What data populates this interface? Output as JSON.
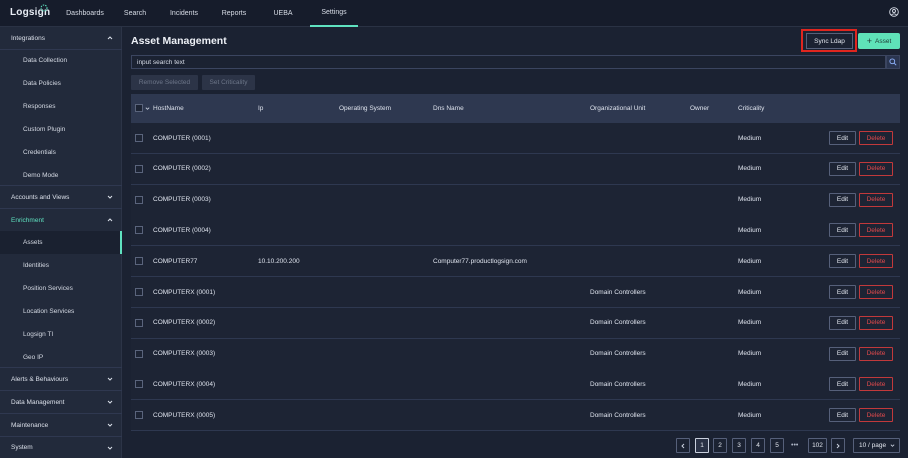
{
  "app": {
    "logo": "Logsign"
  },
  "nav": [
    {
      "label": "Dashboards",
      "active": false
    },
    {
      "label": "Search",
      "active": false
    },
    {
      "label": "Incidents",
      "active": false
    },
    {
      "label": "Reports",
      "active": false
    },
    {
      "label": "UEBA",
      "active": false
    },
    {
      "label": "Settings",
      "active": true
    }
  ],
  "sidebar": {
    "groups": [
      {
        "label": "Integrations",
        "expanded": true,
        "items": [
          "Data Collection",
          "Data Policies",
          "Responses",
          "Custom Plugin",
          "Credentials",
          "Demo Mode"
        ]
      },
      {
        "label": "Accounts and Views",
        "expanded": false,
        "items": []
      },
      {
        "label": "Enrichment",
        "expanded": true,
        "items": [
          "Assets",
          "Identities",
          "Position Services",
          "Location Services",
          "Logsign TI",
          "Geo IP"
        ]
      },
      {
        "label": "Alerts & Behaviours",
        "expanded": false,
        "items": []
      },
      {
        "label": "Data Management",
        "expanded": false,
        "items": []
      },
      {
        "label": "Maintenance",
        "expanded": false,
        "items": []
      },
      {
        "label": "System",
        "expanded": false,
        "items": []
      }
    ],
    "active_item": "Assets"
  },
  "page": {
    "title": "Asset Management",
    "sync_button": "Sync Ldap",
    "add_button": "Asset",
    "search_placeholder": "input search text",
    "remove_selected": "Remove Selected",
    "set_criticality": "Set Criticality"
  },
  "table": {
    "columns": [
      "HostName",
      "Ip",
      "Operating System",
      "Dns Name",
      "Organizational Unit",
      "Owner",
      "Criticality"
    ],
    "edit_label": "Edit",
    "delete_label": "Delete",
    "rows": [
      {
        "hostname": "COMPUTER (0001)",
        "ip": "",
        "os": "",
        "dns": "",
        "ou": "",
        "owner": "",
        "criticality": "Medium"
      },
      {
        "hostname": "COMPUTER (0002)",
        "ip": "",
        "os": "",
        "dns": "",
        "ou": "",
        "owner": "",
        "criticality": "Medium"
      },
      {
        "hostname": "COMPUTER (0003)",
        "ip": "",
        "os": "",
        "dns": "",
        "ou": "",
        "owner": "",
        "criticality": "Medium"
      },
      {
        "hostname": "COMPUTER (0004)",
        "ip": "",
        "os": "",
        "dns": "",
        "ou": "",
        "owner": "",
        "criticality": "Medium"
      },
      {
        "hostname": "COMPUTER77",
        "ip": "10.10.200.200",
        "os": "",
        "dns": "Computer77.productlogsign.com",
        "ou": "",
        "owner": "",
        "criticality": "Medium"
      },
      {
        "hostname": "COMPUTERX (0001)",
        "ip": "",
        "os": "",
        "dns": "",
        "ou": "Domain Controllers",
        "owner": "",
        "criticality": "Medium"
      },
      {
        "hostname": "COMPUTERX (0002)",
        "ip": "",
        "os": "",
        "dns": "",
        "ou": "Domain Controllers",
        "owner": "",
        "criticality": "Medium"
      },
      {
        "hostname": "COMPUTERX (0003)",
        "ip": "",
        "os": "",
        "dns": "",
        "ou": "Domain Controllers",
        "owner": "",
        "criticality": "Medium"
      },
      {
        "hostname": "COMPUTERX (0004)",
        "ip": "",
        "os": "",
        "dns": "",
        "ou": "Domain Controllers",
        "owner": "",
        "criticality": "Medium"
      },
      {
        "hostname": "COMPUTERX (0005)",
        "ip": "",
        "os": "",
        "dns": "",
        "ou": "Domain Controllers",
        "owner": "",
        "criticality": "Medium"
      }
    ]
  },
  "pagination": {
    "pages": [
      "1",
      "2",
      "3",
      "4",
      "5"
    ],
    "ellipsis": "•••",
    "last_page": "102",
    "current": "1",
    "page_size": "10 / page"
  },
  "colors": {
    "accent": "#5fe2c0",
    "danger": "#e24a4c",
    "highlight_box": "#e0261f"
  }
}
